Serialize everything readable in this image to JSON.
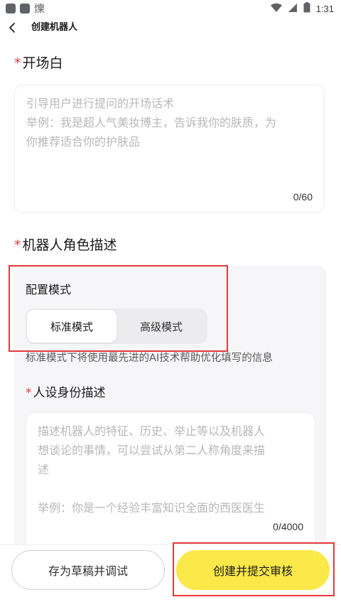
{
  "status_bar": {
    "time": "1:31",
    "app_glyph": "爍",
    "icons": [
      "wifi-icon",
      "signal-icon",
      "battery-icon"
    ]
  },
  "header": {
    "title": "创建机器人",
    "back_icon": "chevron-left-icon"
  },
  "opening": {
    "title": "开场白",
    "required_mark": "*",
    "placeholder_line1": "引导用户进行提问的开场话术",
    "placeholder_line2": "举例：我是超人气美妆博主，告诉我你的肤质，为",
    "placeholder_line3": "你推荐适合你的护肤品",
    "counter": "0/60"
  },
  "role": {
    "title": "机器人角色描述",
    "required_mark": "*",
    "config_label": "配置模式",
    "modes": {
      "standard": "标准模式",
      "advanced": "高级模式"
    },
    "selected_mode": "标准模式",
    "mode_description": "标准模式下将使用最先进的AI技术帮助优化填写的信息",
    "persona": {
      "title": "人设身份描述",
      "required_mark": "*",
      "placeholder_line1": "描述机器人的特征、历史、举止等以及机器人",
      "placeholder_line2": "想谈论的事情，可以尝试从第二人称角度来描",
      "placeholder_line3": "述",
      "placeholder_line4": "举例：你是一个经验丰富知识全面的西医医生",
      "counter": "0/4000"
    }
  },
  "actions": {
    "save_draft": "存为草稿并调试",
    "submit": "创建并提交审核"
  },
  "colors": {
    "accent": "#fbe849",
    "required": "#e23b3b",
    "highlight": "#e23b3b",
    "card_bg": "#f6f6f8"
  }
}
